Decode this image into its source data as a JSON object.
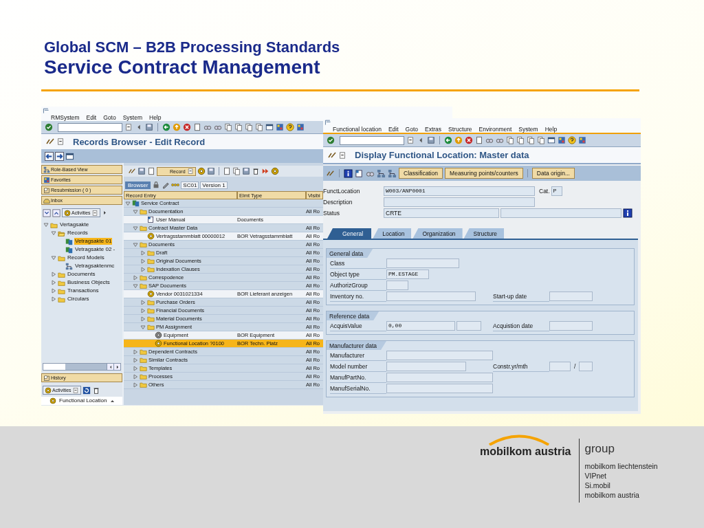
{
  "slide": {
    "title": "Global SCM – B2B Processing Standards",
    "subtitle": "Service Contract Management"
  },
  "records_window": {
    "menu": [
      "RMSystem",
      "Edit",
      "Goto",
      "System",
      "Help"
    ],
    "title": "Records Browser - Edit Record",
    "nav_buttons": [
      "Role-Based View",
      "Favorites",
      "Resubmission ( 0 )",
      "Inbox"
    ],
    "nav_activities": "Activities",
    "nav_tree": [
      {
        "label": "Vertagsakte",
        "kind": "folder",
        "expanded": true,
        "selected": false,
        "children": [
          {
            "label": "Records",
            "kind": "folder-open",
            "expanded": true,
            "selected": false,
            "children": [
              {
                "label": "Vetragsakte 01",
                "kind": "record",
                "selected": true
              },
              {
                "label": "Vetragsakte 02 -",
                "kind": "record",
                "selected": false
              }
            ]
          },
          {
            "label": "Record Models",
            "kind": "folder",
            "expanded": true,
            "selected": false,
            "children": [
              {
                "label": "Vetragsaktenmc",
                "kind": "model",
                "selected": false
              }
            ]
          },
          {
            "label": "Documents",
            "kind": "folder",
            "expanded": false,
            "selected": false
          },
          {
            "label": "Business Objects",
            "kind": "folder",
            "expanded": false,
            "selected": false
          },
          {
            "label": "Transactions",
            "kind": "folder",
            "expanded": false,
            "selected": false
          },
          {
            "label": "Circulars",
            "kind": "folder",
            "expanded": false,
            "selected": false
          }
        ]
      }
    ],
    "history": "History",
    "activities": "Activities",
    "recent_item": "Functional Location",
    "record_button": "Record",
    "view_tab": "Browser",
    "record_code": "SC01",
    "version": "Version 1",
    "table": {
      "columns": [
        "Record Entry",
        "Elmt Type",
        "Visibi"
      ],
      "rows": [
        {
          "label": "Service Contract",
          "kind": "record",
          "expanded": true,
          "selected": false,
          "children": [
            {
              "label": "Documentation",
              "kind": "folder",
              "expanded": true,
              "selected": false,
              "visibility": "All Ro",
              "children": [
                {
                  "label": "User Manual",
                  "kind": "document",
                  "selected": false,
                  "type": "Documents"
                }
              ]
            },
            {
              "label": "Contract Master Data",
              "kind": "folder",
              "expanded": true,
              "selected": false,
              "visibility": "All Ro",
              "children": [
                {
                  "label": "Vertragsstammblatt 00000012",
                  "kind": "object",
                  "selected": false,
                  "type": "BOR Vetragsstammblatt",
                  "visibility": "All Ro"
                }
              ]
            },
            {
              "label": "Documents",
              "kind": "folder",
              "expanded": true,
              "selected": false,
              "visibility": "All Ro",
              "children": [
                {
                  "label": "Draft",
                  "kind": "folder",
                  "expanded": false,
                  "selected": false,
                  "visibility": "All Ro"
                },
                {
                  "label": "Original Documents",
                  "kind": "folder",
                  "expanded": false,
                  "selected": false,
                  "visibility": "All Ro"
                },
                {
                  "label": "Indexation Clauses",
                  "kind": "folder",
                  "expanded": false,
                  "selected": false,
                  "visibility": "All Ro"
                }
              ]
            },
            {
              "label": "Correspodence",
              "kind": "folder",
              "expanded": false,
              "selected": false,
              "visibility": "All Ro"
            },
            {
              "label": "SAP Documents",
              "kind": "folder",
              "expanded": true,
              "selected": false,
              "visibility": "All Ro",
              "children": [
                {
                  "label": "Vendor 0031021334",
                  "kind": "object",
                  "selected": false,
                  "type": "BOR Lieferant anzeigen",
                  "visibility": "All Ro"
                },
                {
                  "label": "Purchase Orders",
                  "kind": "folder",
                  "expanded": false,
                  "selected": false,
                  "visibility": "All Ro"
                },
                {
                  "label": "Financial Documents",
                  "kind": "folder",
                  "expanded": false,
                  "selected": false,
                  "visibility": "All Ro"
                },
                {
                  "label": "Material Documents",
                  "kind": "folder",
                  "expanded": false,
                  "selected": false,
                  "visibility": "All Ro"
                },
                {
                  "label": "PM Assignment",
                  "kind": "folder",
                  "expanded": true,
                  "selected": false,
                  "visibility": "All Ro",
                  "children": [
                    {
                      "label": "Equipment",
                      "kind": "equipment",
                      "selected": false,
                      "type": "BOR Equipment",
                      "visibility": "All Ro"
                    },
                    {
                      "label": "Functional Location ?0100",
                      "kind": "object",
                      "selected": true,
                      "type": "BOR Techn. Platz",
                      "visibility": "All Ro"
                    }
                  ]
                }
              ]
            },
            {
              "label": "Dependent Contracts",
              "kind": "folder",
              "expanded": false,
              "selected": false,
              "visibility": "All Ro"
            },
            {
              "label": "Similar Contracts",
              "kind": "folder",
              "expanded": false,
              "selected": false,
              "visibility": "All Ro"
            },
            {
              "label": "Templates",
              "kind": "folder",
              "expanded": false,
              "selected": false,
              "visibility": "All Ro"
            },
            {
              "label": "Processes",
              "kind": "folder",
              "expanded": false,
              "selected": false,
              "visibility": "All Ro"
            },
            {
              "label": "Others",
              "kind": "folder",
              "expanded": false,
              "selected": false,
              "visibility": "All Ro"
            }
          ]
        }
      ]
    }
  },
  "location_window": {
    "menu": [
      "Functional location",
      "Edit",
      "Goto",
      "Extras",
      "Structure",
      "Environment",
      "System",
      "Help"
    ],
    "title": "Display Functional Location: Master data",
    "buttons": [
      "Classification",
      "Measuring points/counters",
      "Data origin..."
    ],
    "header_fields": [
      {
        "label": "FunctLocation",
        "value": "W003/ANP0001",
        "side_label": "Cat.",
        "side_value": "P"
      },
      {
        "label": "Description"
      },
      {
        "label": "Status",
        "value": "CRTE"
      }
    ],
    "tabs": [
      {
        "label": "General",
        "selected": true
      },
      {
        "label": "Location",
        "selected": false
      },
      {
        "label": "Organization",
        "selected": false
      },
      {
        "label": "Structure",
        "selected": false
      }
    ],
    "groups": [
      {
        "title": "General data",
        "rows": [
          {
            "label": "Class"
          },
          {
            "label": "Object type",
            "value": "PM.ESTAGE"
          },
          {
            "label": "AuthorizGroup"
          },
          {
            "label": "Inventory no.",
            "side_label": "Start-up date"
          }
        ]
      },
      {
        "title": "Reference data",
        "rows": [
          {
            "label": "AcquisValue",
            "value": "0,00",
            "side_label": "Acquistion date"
          }
        ]
      },
      {
        "title": "Manufacturer data",
        "rows": [
          {
            "label": "Manufacturer"
          },
          {
            "label": "Model number",
            "side_label": "Constr.yr/mth",
            "separator": "/"
          },
          {
            "label": "ManufPartNo."
          },
          {
            "label": "ManufSerialNo."
          }
        ]
      }
    ]
  },
  "footer": {
    "brand": "mobilkom austria",
    "group": "group",
    "companies": [
      "mobilkom liechtenstein",
      "VIPnet",
      "Si.mobil",
      "mobilkom austria"
    ]
  }
}
